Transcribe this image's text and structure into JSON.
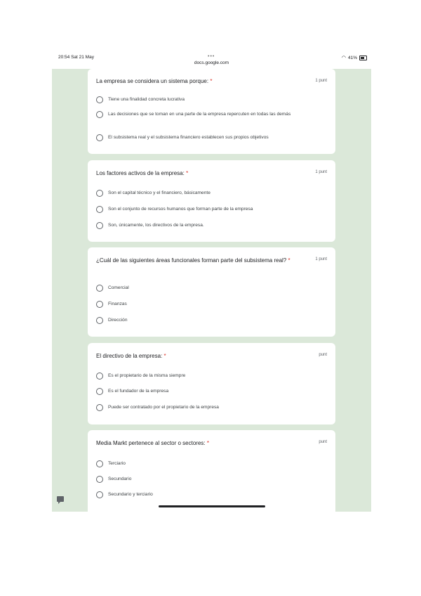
{
  "status_bar": {
    "time": "20:54  Sat 21 May",
    "dots": "•••",
    "url": "docs.google.com",
    "battery": "41%"
  },
  "questions": [
    {
      "title": "La empresa se considera un sistema porque:",
      "required": "*",
      "points": "1 punt",
      "options": [
        "Tiene una finalidad concreta lucrativa",
        "Las decisiones que se toman en una parte de la empresa repercuten en todas las demás",
        "El subsistema real y el subsistema financiero establecen sus propios objetivos"
      ]
    },
    {
      "title": "Los factores activos de la empresa:",
      "required": "*",
      "points": "1 punt",
      "options": [
        "Son el capital técnico y el financiero, básicamente",
        "Son el conjunto de recursos humanos que forman parte de la empresa",
        "Son, únicamente, los directivos de la empresa."
      ]
    },
    {
      "title": "¿Cuál de las siguientes áreas funcionales forman parte del subsistema real?",
      "required": "*",
      "points": "1 punt",
      "options": [
        "Comercial",
        "Finanzas",
        "Dirección"
      ]
    },
    {
      "title": "El directivo de la empresa:",
      "required": "*",
      "points": "punt",
      "options": [
        "Es el propietario de la misma siempre",
        "Es el fundador de la empresa",
        "Puede ser contratado por el propietario de la empresa"
      ]
    },
    {
      "title": "Media Markt pertenece al sector o sectores:",
      "required": "*",
      "points": "punt",
      "options": [
        "Terciario",
        "Secundario",
        "Secundario y terciario"
      ]
    }
  ]
}
